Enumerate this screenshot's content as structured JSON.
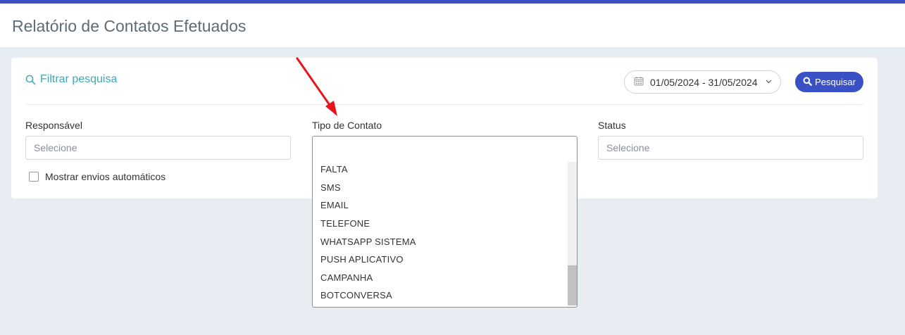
{
  "page": {
    "title": "Relatório de Contatos Efetuados"
  },
  "filter": {
    "title": "Filtrar pesquisa",
    "date_range": "01/05/2024 - 31/05/2024",
    "search_button": "Pesquisar"
  },
  "fields": {
    "responsavel": {
      "label": "Responsável",
      "placeholder": "Selecione"
    },
    "tipo_contato": {
      "label": "Tipo de Contato",
      "options": [
        "FALTA",
        "SMS",
        "EMAIL",
        "TELEFONE",
        "WHATSAPP SISTEMA",
        "PUSH APLICATIVO",
        "CAMPANHA",
        "BOTCONVERSA"
      ]
    },
    "status": {
      "label": "Status",
      "placeholder": "Selecione"
    }
  },
  "checkbox": {
    "label": "Mostrar envios automáticos",
    "checked": false
  },
  "colors": {
    "accent": "#3a50c5",
    "teal": "#43a7b5",
    "annotation_arrow": "#e8141c"
  },
  "icons": [
    "search-icon",
    "calendar-icon",
    "chevron-down-icon",
    "annotation-arrow"
  ]
}
